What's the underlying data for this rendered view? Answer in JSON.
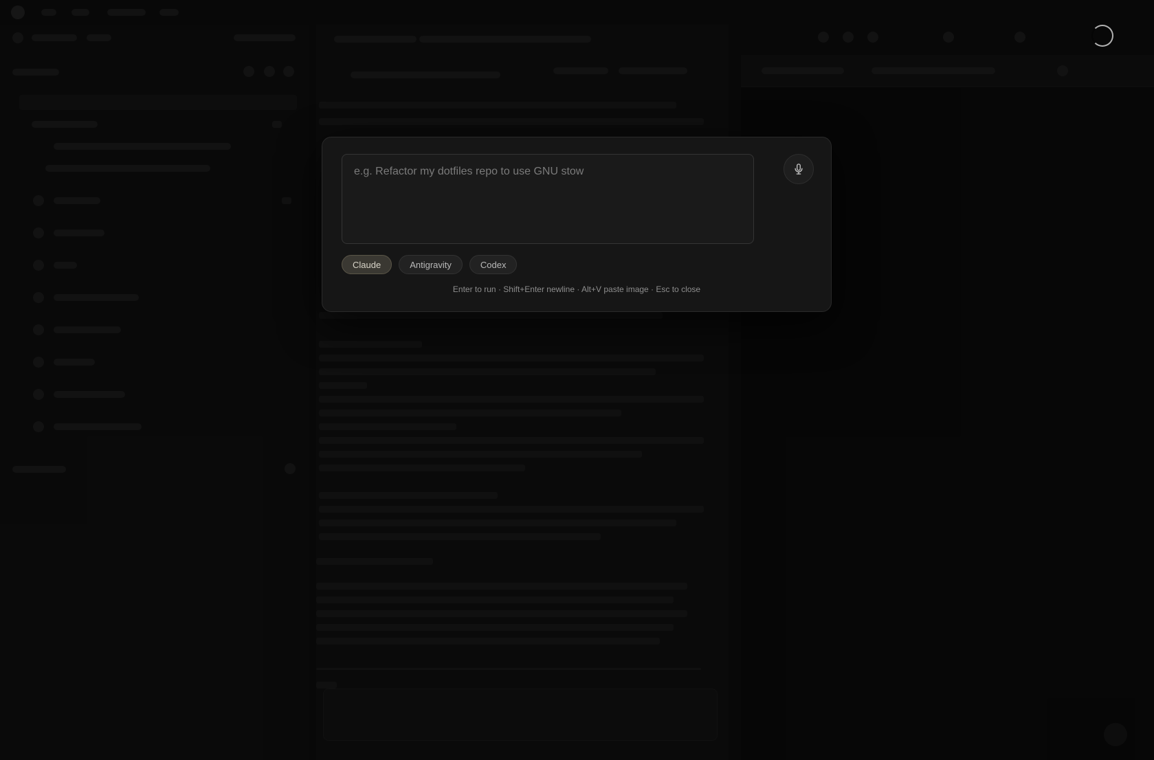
{
  "dialog": {
    "prompt_placeholder": "e.g. Refactor my dotfiles repo to use GNU stow",
    "agents": [
      "Claude",
      "Antigravity",
      "Codex"
    ],
    "selected_agent": "Claude",
    "hint": "Enter to run · Shift+Enter newline · Alt+V paste image · Esc to close",
    "mic_icon": "microphone-icon"
  },
  "background": {
    "loading_indicator_icon": "loading-spinner-icon"
  }
}
